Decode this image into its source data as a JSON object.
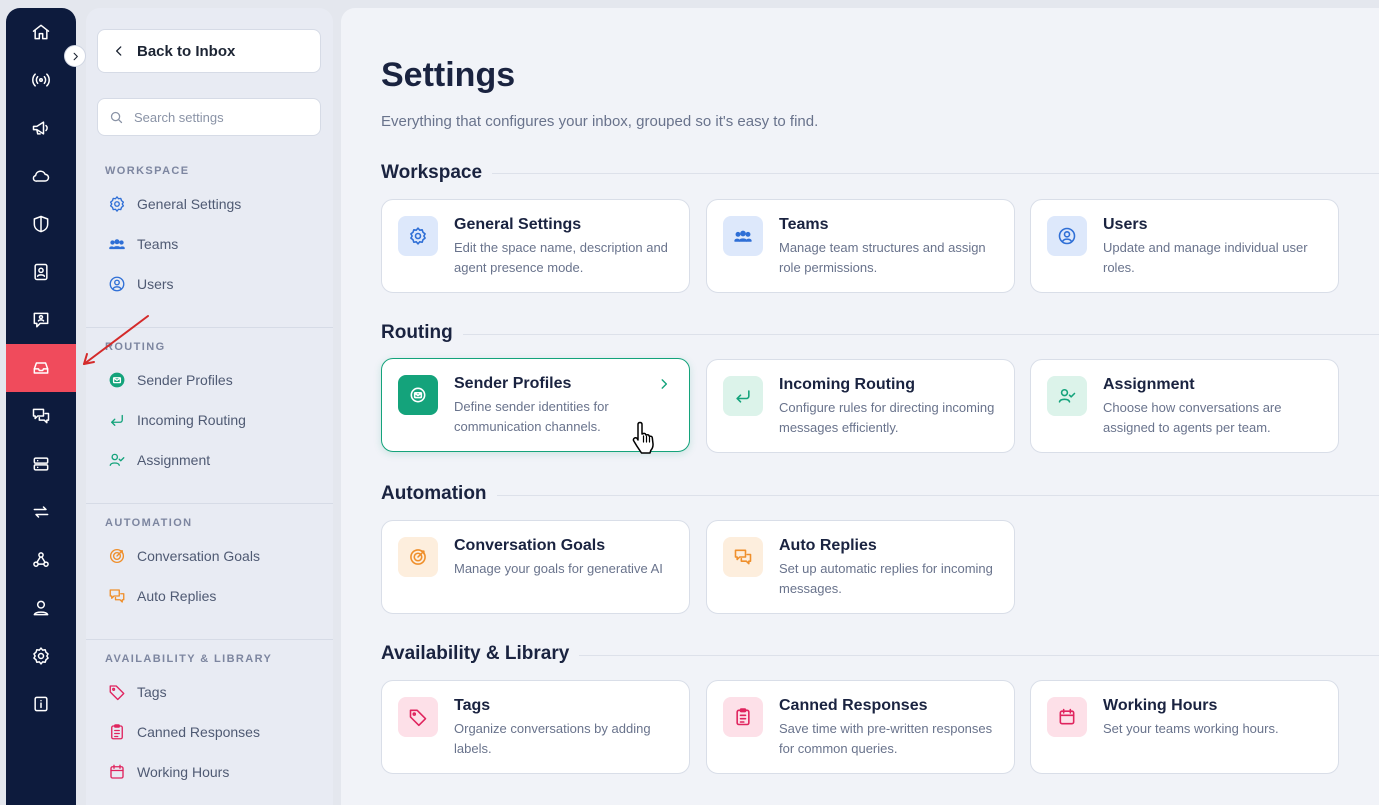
{
  "rail": {
    "items": [
      {
        "icon": "home-icon"
      },
      {
        "icon": "broadcast-icon"
      },
      {
        "icon": "megaphone-icon"
      },
      {
        "icon": "cloud-icon"
      },
      {
        "icon": "shield-icon"
      },
      {
        "icon": "contacts-icon"
      },
      {
        "icon": "chat-user-icon"
      },
      {
        "icon": "inbox-icon",
        "active": true
      },
      {
        "icon": "conversations-icon"
      },
      {
        "icon": "server-icon"
      },
      {
        "icon": "sync-icon"
      },
      {
        "icon": "webhook-icon"
      },
      {
        "icon": "person-icon"
      },
      {
        "icon": "gear-icon"
      },
      {
        "icon": "info-icon"
      }
    ],
    "active_color": "#f04b5c"
  },
  "sidebar": {
    "back_label": "Back to Inbox",
    "search_placeholder": "Search settings",
    "sections": [
      {
        "title": "WORKSPACE",
        "items": [
          {
            "label": "General Settings",
            "icon": "gear-icon"
          },
          {
            "label": "Teams",
            "icon": "teams-icon"
          },
          {
            "label": "Users",
            "icon": "user-circle-icon"
          }
        ]
      },
      {
        "title": "ROUTING",
        "items": [
          {
            "label": "Sender Profiles",
            "icon": "sender-icon"
          },
          {
            "label": "Incoming Routing",
            "icon": "return-arrow-icon"
          },
          {
            "label": "Assignment",
            "icon": "user-check-icon"
          }
        ]
      },
      {
        "title": "AUTOMATION",
        "items": [
          {
            "label": "Conversation Goals",
            "icon": "target-icon"
          },
          {
            "label": "Auto Replies",
            "icon": "chat-bubbles-icon"
          }
        ]
      },
      {
        "title": "AVAILABILITY & LIBRARY",
        "items": [
          {
            "label": "Tags",
            "icon": "tag-icon"
          },
          {
            "label": "Canned Responses",
            "icon": "clipboard-icon"
          },
          {
            "label": "Working Hours",
            "icon": "calendar-icon"
          }
        ]
      }
    ]
  },
  "main": {
    "title": "Settings",
    "subtitle": "Everything that configures your inbox, grouped so it's easy to find.",
    "groups": [
      {
        "title": "Workspace",
        "cards": [
          {
            "title": "General Settings",
            "desc": "Edit the space name, description and agent presence mode.",
            "icon": "gear-icon"
          },
          {
            "title": "Teams",
            "desc": "Manage team structures and assign role permissions.",
            "icon": "teams-icon"
          },
          {
            "title": "Users",
            "desc": "Update and manage individual user roles.",
            "icon": "user-circle-icon"
          }
        ]
      },
      {
        "title": "Routing",
        "cards": [
          {
            "title": "Sender Profiles",
            "desc": "Define sender identities for communication channels.",
            "icon": "sender-icon",
            "selected": true
          },
          {
            "title": "Incoming Routing",
            "desc": "Configure rules for directing incoming messages efficiently.",
            "icon": "return-arrow-icon"
          },
          {
            "title": "Assignment",
            "desc": "Choose how conversations are assigned to agents per team.",
            "icon": "user-check-icon"
          }
        ]
      },
      {
        "title": "Automation",
        "cards": [
          {
            "title": "Conversation Goals",
            "desc": "Manage your goals for generative AI",
            "icon": "target-icon"
          },
          {
            "title": "Auto Replies",
            "desc": "Set up automatic replies for incoming messages.",
            "icon": "chat-bubbles-icon"
          }
        ]
      },
      {
        "title": "Availability & Library",
        "cards": [
          {
            "title": "Tags",
            "desc": "Organize conversations by adding labels.",
            "icon": "tag-icon"
          },
          {
            "title": "Canned Responses",
            "desc": "Save time with pre-written responses for common queries.",
            "icon": "clipboard-icon"
          },
          {
            "title": "Working Hours",
            "desc": "Set your teams working hours.",
            "icon": "calendar-icon"
          }
        ]
      }
    ]
  },
  "colors": {
    "workspace": "#2f6fd6",
    "workspace_bg": "#dde8fb",
    "routing": "#14a37b",
    "routing_bg": "#dcf3ea",
    "automation": "#ef8f2b",
    "automation_bg": "#fdeedd",
    "library": "#e0245e",
    "library_bg": "#fde0e8"
  }
}
